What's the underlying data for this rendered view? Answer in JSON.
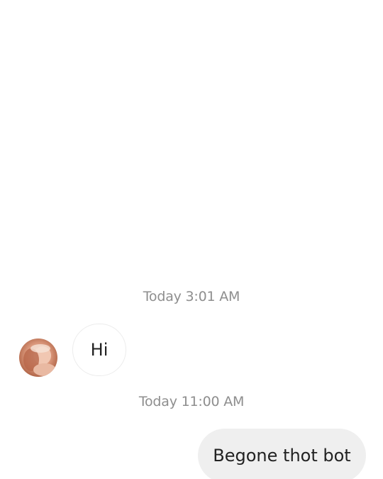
{
  "messages": [
    {
      "timestamp": "Today 3:01 AM",
      "sender": "other",
      "text": "Hi",
      "avatar_icon": "contact-avatar-photo"
    },
    {
      "timestamp": "Today 11:00 AM",
      "sender": "me",
      "text": "Begone thot bot"
    }
  ],
  "colors": {
    "timestamp_text": "#8e8e8e",
    "incoming_bubble_border": "#ececec",
    "outgoing_bubble_bg": "#efefef",
    "message_text": "#222222"
  }
}
